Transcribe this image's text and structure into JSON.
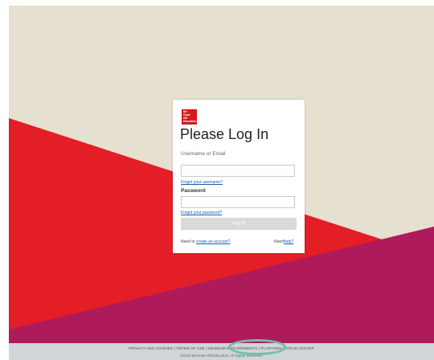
{
  "login": {
    "logo_text": "Mc\nGraw\nHill\nEducation",
    "title": "Please Log In",
    "username_label": "Username or Email",
    "username_value": "",
    "forgot_username": "Forgot your username?",
    "password_label": "Password",
    "password_value": "",
    "forgot_password": "Forgot your password?",
    "login_button": "Log In",
    "need_to": "Need to",
    "create_account": "create an account?",
    "need": "Need",
    "help": "help?"
  },
  "footer": {
    "privacy": "PRIVACY AND COOKIES",
    "terms": "TERMS OF USE",
    "min_req": "MINIMUM REQUIREMENTS",
    "platform": "PLATFORM STATUS CENTER",
    "sep": "|",
    "copyright": "©2018 McGraw-Hill Education. All Rights Reserved."
  },
  "colors": {
    "background_beige": "#e5e0cf",
    "red": "#e31e26",
    "magenta": "#ae1a5a",
    "annotation": "#6fc1a8"
  }
}
